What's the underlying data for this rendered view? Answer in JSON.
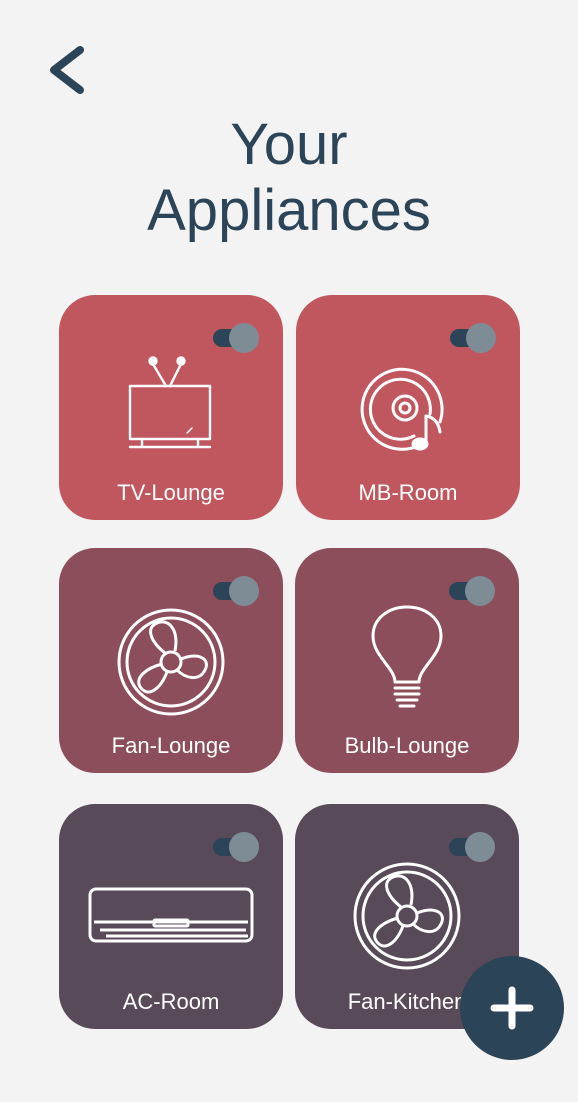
{
  "page": {
    "title_line1": "Your",
    "title_line2": "Appliances"
  },
  "appliances": [
    {
      "label": "TV-Lounge",
      "icon": "tv-icon",
      "color": "#c0575f",
      "on": true
    },
    {
      "label": "MB-Room",
      "icon": "music-disc-icon",
      "color": "#c0575f",
      "on": true
    },
    {
      "label": "Fan-Lounge",
      "icon": "fan-icon",
      "color": "#8c4e5a",
      "on": true
    },
    {
      "label": "Bulb-Lounge",
      "icon": "bulb-icon",
      "color": "#8c4e5a",
      "on": true
    },
    {
      "label": "AC-Room",
      "icon": "ac-icon",
      "color": "#584a58",
      "on": true
    },
    {
      "label": "Fan-Kitchen",
      "icon": "fan-icon",
      "color": "#584a58",
      "on": true
    }
  ],
  "colors": {
    "background": "#f3f3f3",
    "primary": "#2c4457",
    "toggle_knob": "#7e8c96"
  },
  "icons": {
    "back": "chevron-left-icon",
    "fab": "plus-icon"
  }
}
